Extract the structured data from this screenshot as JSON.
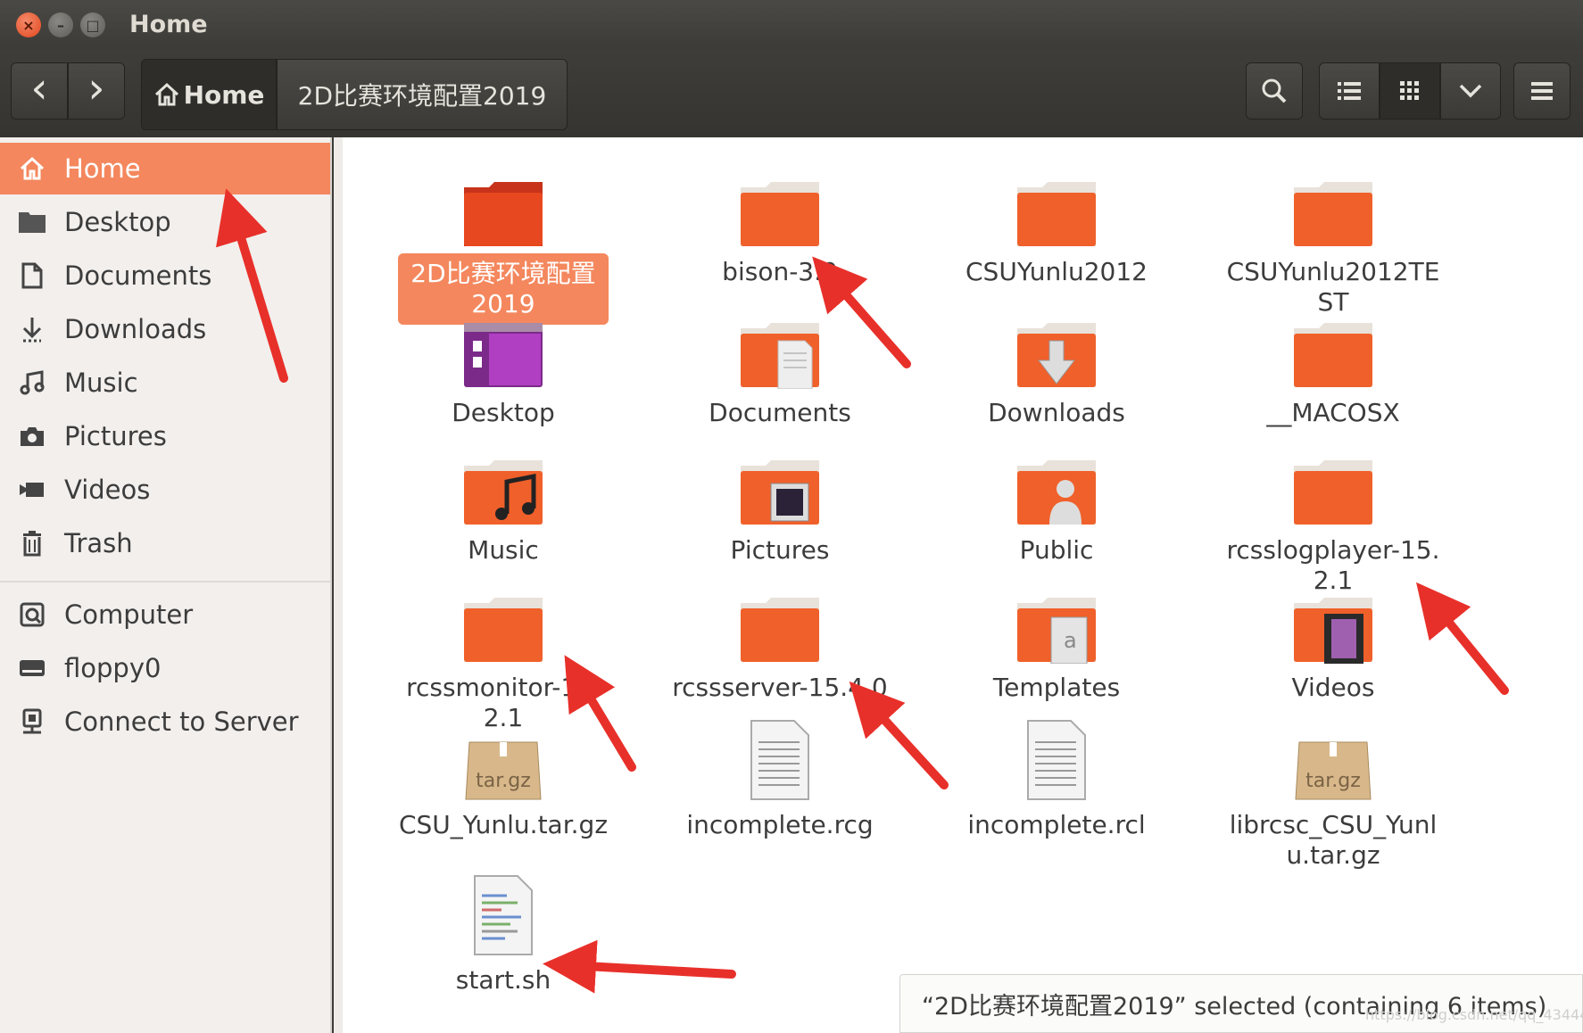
{
  "window": {
    "title": "Home",
    "close_glyph": "×",
    "min_glyph": "–",
    "max_glyph": "□"
  },
  "toolbar": {
    "back_glyph": "‹",
    "forward_glyph": "›",
    "crumbs": [
      "Home",
      "2D比赛环境配置2019"
    ],
    "icons": [
      "search-icon",
      "list-view-icon",
      "grid-view-icon",
      "chevron-down-icon",
      "hamburger-menu-icon"
    ]
  },
  "sidebar": {
    "items": [
      {
        "label": "Home",
        "icon": "home-icon",
        "active": true
      },
      {
        "label": "Desktop",
        "icon": "desktop-icon"
      },
      {
        "label": "Documents",
        "icon": "document-icon"
      },
      {
        "label": "Downloads",
        "icon": "download-icon"
      },
      {
        "label": "Music",
        "icon": "music-icon"
      },
      {
        "label": "Pictures",
        "icon": "camera-icon"
      },
      {
        "label": "Videos",
        "icon": "video-icon"
      },
      {
        "label": "Trash",
        "icon": "trash-icon"
      }
    ],
    "devices": [
      {
        "label": "Computer",
        "icon": "computer-icon"
      },
      {
        "label": "floppy0",
        "icon": "drive-icon"
      },
      {
        "label": "Connect to Server",
        "icon": "server-icon"
      }
    ]
  },
  "files": [
    {
      "name": "2D比赛环境配置2019",
      "type": "folder",
      "selected": true
    },
    {
      "name": "bison-3.0",
      "type": "folder"
    },
    {
      "name": "CSUYunlu2012",
      "type": "folder"
    },
    {
      "name": "CSUYunlu2012TEST",
      "type": "folder"
    },
    {
      "name": "Desktop",
      "type": "desktop"
    },
    {
      "name": "Documents",
      "type": "documents"
    },
    {
      "name": "Downloads",
      "type": "downloads"
    },
    {
      "name": "__MACOSX",
      "type": "folder"
    },
    {
      "name": "Music",
      "type": "music"
    },
    {
      "name": "Pictures",
      "type": "pictures"
    },
    {
      "name": "Public",
      "type": "public"
    },
    {
      "name": "rcsslogplayer-15.2.1",
      "type": "folder"
    },
    {
      "name": "rcssmonitor-15.2.1",
      "type": "folder"
    },
    {
      "name": "rcssserver-15.4.0",
      "type": "folder"
    },
    {
      "name": "Templates",
      "type": "templates"
    },
    {
      "name": "Videos",
      "type": "videos"
    },
    {
      "name": "CSU_Yunlu.tar.gz",
      "type": "archive"
    },
    {
      "name": "incomplete.rcg",
      "type": "text"
    },
    {
      "name": "incomplete.rcl",
      "type": "text"
    },
    {
      "name": "librcsc_CSU_Yunlu.tar.gz",
      "type": "archive"
    },
    {
      "name": "start.sh",
      "type": "script"
    }
  ],
  "archive_label": "tar.gz",
  "status": "“2D比赛环境配置2019” selected (containing 6 items)",
  "watermark": "https://blog.csdn.net/qq_43444767",
  "colors": {
    "accent": "#f4875d",
    "folder": "#f0602a",
    "arrow": "#e8302a"
  }
}
